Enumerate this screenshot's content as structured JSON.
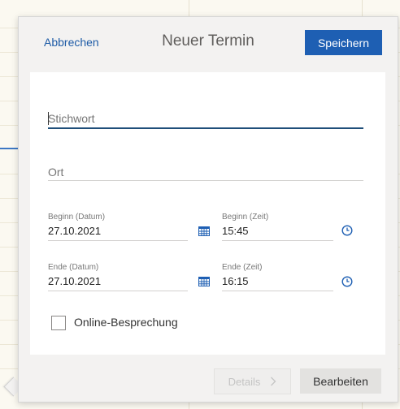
{
  "dialog": {
    "title": "Neuer Termin",
    "cancel_label": "Abbrechen",
    "save_label": "Speichern"
  },
  "form": {
    "subject_placeholder": "Stichwort",
    "location_placeholder": "Ort",
    "start_date_label": "Beginn (Datum)",
    "start_date_value": "27.10.2021",
    "start_time_label": "Beginn (Zeit)",
    "start_time_value": "15:45",
    "end_date_label": "Ende (Datum)",
    "end_date_value": "27.10.2021",
    "end_time_label": "Ende (Zeit)",
    "end_time_value": "16:15",
    "online_meeting_label": "Online-Besprechung",
    "online_meeting_checked": false
  },
  "footer": {
    "details_label": "Details",
    "edit_label": "Bearbeiten"
  },
  "icons": {
    "calendar": "calendar-icon",
    "clock": "clock-icon",
    "chevron": "chevron-right-icon"
  },
  "colors": {
    "accent": "#1e5fb3",
    "link": "#1d5ba6",
    "active_underline": "#1f4e79"
  }
}
